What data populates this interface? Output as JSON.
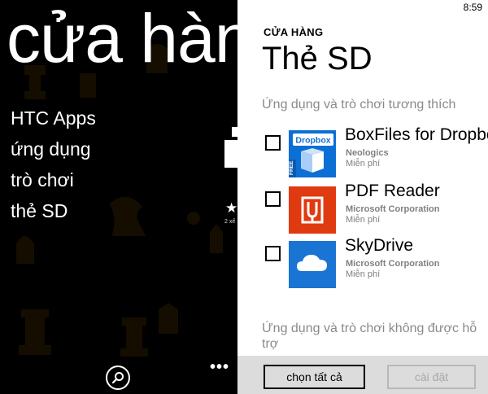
{
  "hub": {
    "title": "cửa hàng",
    "menu": [
      "HTC Apps",
      "ứng dụng",
      "trò chơi",
      "thẻ SD"
    ],
    "peek_rating_text": "2 xế"
  },
  "dialog": {
    "status_time": "8:59",
    "section_label": "CỬA HÀNG",
    "title": "Thẻ SD",
    "compatible_header": "Ứng dụng và trò chơi tương thích",
    "apps": [
      {
        "name": "BoxFiles for Dropbox",
        "publisher": "Neologics",
        "price": "Miễn phí",
        "icon": "dropbox-box-icon",
        "tile_color": "#0b6fd6",
        "tile_text": "Dropbox",
        "badge": "FREE"
      },
      {
        "name": "PDF Reader",
        "publisher": "Microsoft Corporation",
        "price": "Miễn phí",
        "icon": "pdf-reader-icon",
        "tile_color": "#e03a10"
      },
      {
        "name": "SkyDrive",
        "publisher": "Microsoft Corporation",
        "price": "Miễn phí",
        "icon": "cloud-icon",
        "tile_color": "#1a74d4"
      }
    ],
    "unsupported_header": "Ứng dụng và trò chơi không được hỗ trợ",
    "buttons": {
      "select_all": "chọn tất cả",
      "install": "cài đặt"
    }
  },
  "colors": {
    "accent_dropbox": "#0b6fd6",
    "accent_pdf": "#e03a10",
    "accent_skydrive": "#1a74d4",
    "dialog_bg": "#ffffff",
    "appbar_bg": "#dcdcdc"
  }
}
